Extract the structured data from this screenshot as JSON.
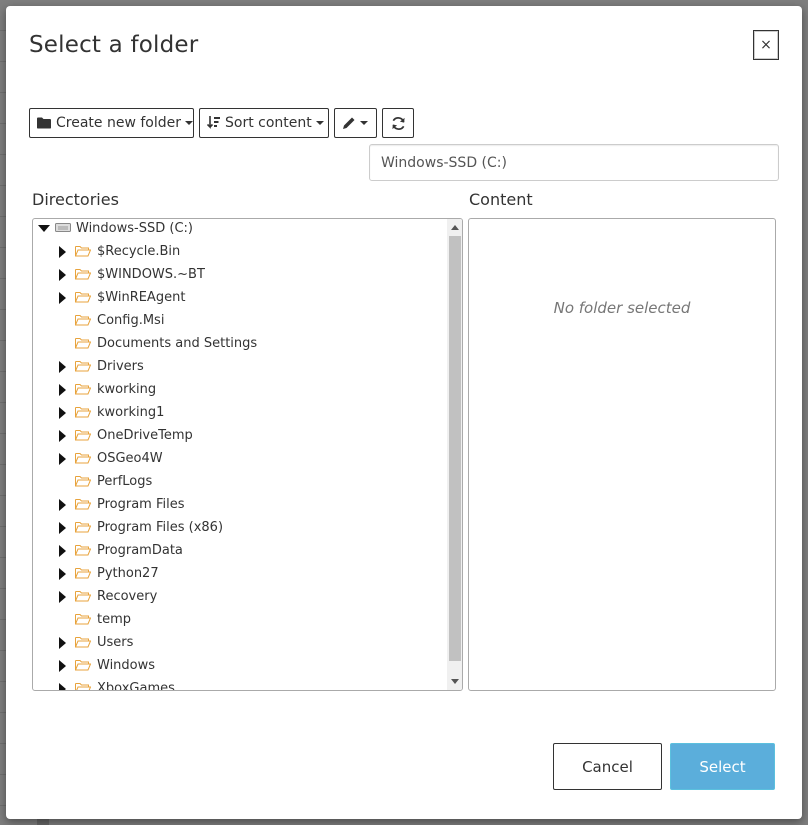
{
  "dialog": {
    "title": "Select a folder",
    "close_label": "×"
  },
  "toolbar": {
    "create_folder_label": "Create new folder",
    "sort_label": "Sort content"
  },
  "path_input": {
    "value": "Windows-SSD (C:)"
  },
  "directories": {
    "label": "Directories",
    "root": "Windows-SSD (C:)",
    "items": [
      {
        "label": "$Recycle.Bin",
        "expandable": true
      },
      {
        "label": "$WINDOWS.~BT",
        "expandable": true
      },
      {
        "label": "$WinREAgent",
        "expandable": true
      },
      {
        "label": "Config.Msi",
        "expandable": false
      },
      {
        "label": "Documents and Settings",
        "expandable": false
      },
      {
        "label": "Drivers",
        "expandable": true
      },
      {
        "label": "kworking",
        "expandable": true
      },
      {
        "label": "kworking1",
        "expandable": true
      },
      {
        "label": "OneDriveTemp",
        "expandable": true
      },
      {
        "label": "OSGeo4W",
        "expandable": true
      },
      {
        "label": "PerfLogs",
        "expandable": false
      },
      {
        "label": "Program Files",
        "expandable": true
      },
      {
        "label": "Program Files (x86)",
        "expandable": true
      },
      {
        "label": "ProgramData",
        "expandable": true
      },
      {
        "label": "Python27",
        "expandable": true
      },
      {
        "label": "Recovery",
        "expandable": true
      },
      {
        "label": "temp",
        "expandable": false
      },
      {
        "label": "Users",
        "expandable": true
      },
      {
        "label": "Windows",
        "expandable": true
      },
      {
        "label": "XboxGames",
        "expandable": true
      }
    ]
  },
  "content": {
    "label": "Content",
    "empty_message": "No folder selected"
  },
  "footer": {
    "cancel_label": "Cancel",
    "select_label": "Select"
  },
  "colors": {
    "primary": "#5baedb",
    "folder": "#e8a33c"
  }
}
